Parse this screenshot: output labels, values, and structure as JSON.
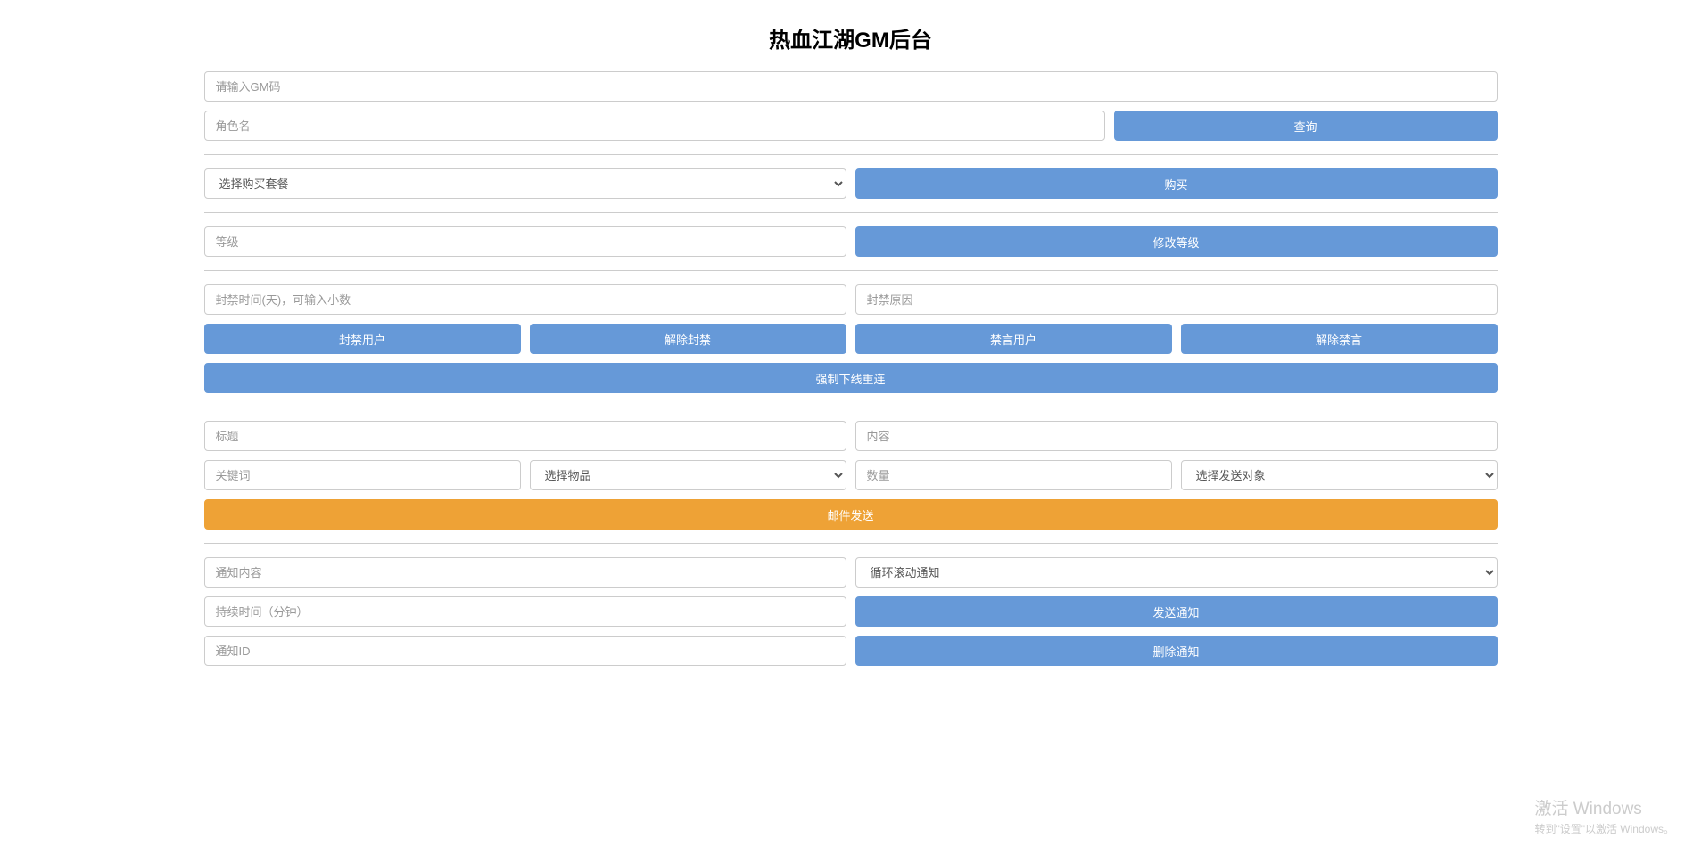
{
  "title": "热血江湖GM后台",
  "gm_code": {
    "placeholder": "请输入GM码"
  },
  "query": {
    "role_name_placeholder": "角色名",
    "button": "查询"
  },
  "package": {
    "select_label": "选择购买套餐",
    "buy_button": "购买"
  },
  "level": {
    "placeholder": "等级",
    "button": "修改等级"
  },
  "ban": {
    "time_placeholder": "封禁时间(天)，可输入小数",
    "reason_placeholder": "封禁原因",
    "ban_user": "封禁用户",
    "unban_user": "解除封禁",
    "mute_user": "禁言用户",
    "unmute_user": "解除禁言",
    "force_offline": "强制下线重连"
  },
  "mail": {
    "title_placeholder": "标题",
    "content_placeholder": "内容",
    "keyword_placeholder": "关键词",
    "select_item": "选择物品",
    "quantity_placeholder": "数量",
    "select_target": "选择发送对象",
    "send_button": "邮件发送"
  },
  "notice": {
    "content_placeholder": "通知内容",
    "type_select": "循环滚动通知",
    "duration_placeholder": "持续时间（分钟）",
    "send_button": "发送通知",
    "id_placeholder": "通知ID",
    "delete_button": "删除通知"
  },
  "watermark": {
    "title": "激活 Windows",
    "sub": "转到\"设置\"以激活 Windows。"
  }
}
